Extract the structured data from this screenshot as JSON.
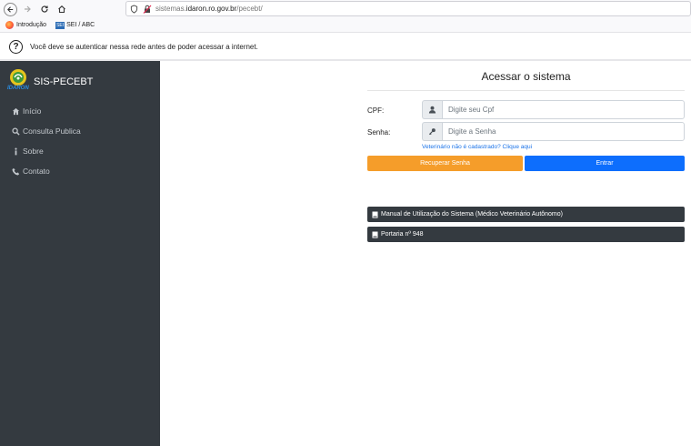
{
  "browser": {
    "url_prefix": "sistemas.",
    "url_host": "idaron.ro.gov.br",
    "url_path": "/pecebt/",
    "bookmarks": [
      {
        "label": "Introdução"
      },
      {
        "label": "SEI / ABC"
      }
    ],
    "sei_badge": "SEI"
  },
  "notice": {
    "text": "Você deve se autenticar nessa rede antes de poder acessar a internet."
  },
  "sidebar": {
    "brand_title": "SIS-PECEBT",
    "brand_sub": "IDARON",
    "items": [
      {
        "label": "Início",
        "icon": "home-icon"
      },
      {
        "label": "Consulta Publica",
        "icon": "search-icon"
      },
      {
        "label": "Sobre",
        "icon": "info-icon"
      },
      {
        "label": "Contato",
        "icon": "phone-icon"
      }
    ]
  },
  "main": {
    "title": "Acessar o sistema",
    "cpf_label": "CPF:",
    "cpf_placeholder": "Digite seu Cpf",
    "senha_label": "Senha:",
    "senha_placeholder": "Digite a Senha",
    "register_link": "Veterinário não é cadastrado? Clique aqui",
    "recover_button": "Recuperar Senha",
    "enter_button": "Entrar",
    "documents": [
      {
        "label": "Manual de Utilização do Sistema (Médico Veterinário Autônomo)"
      },
      {
        "label": "Portaria nº 948"
      }
    ]
  },
  "colors": {
    "sidebar_bg": "#343a40",
    "recover": "#f59d2a",
    "enter": "#0d6efd",
    "link": "#1a73e8"
  }
}
